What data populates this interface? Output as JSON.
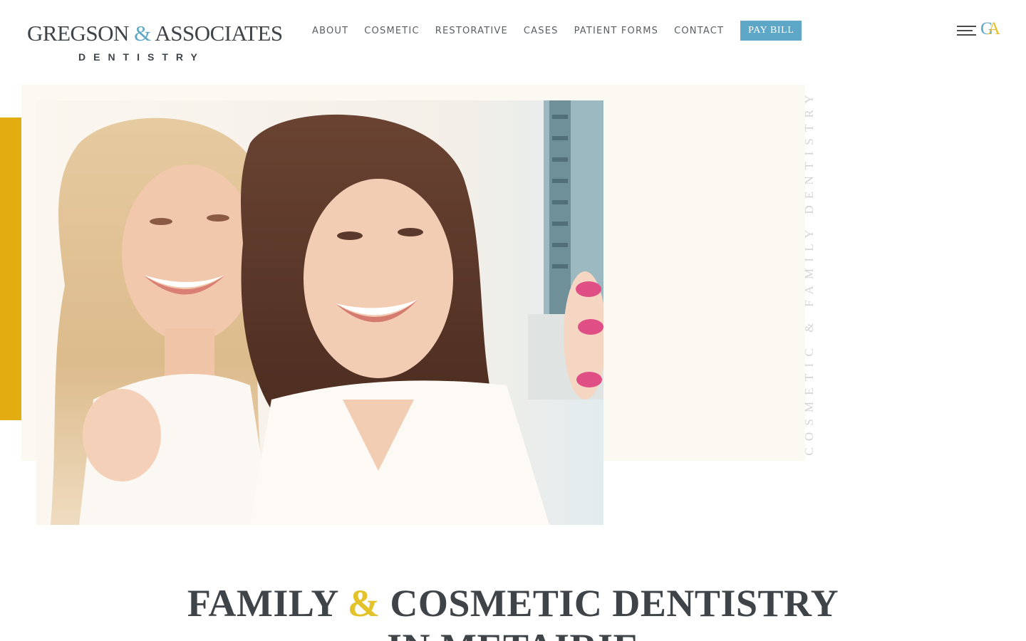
{
  "brand": {
    "name_part1": "GREGSON",
    "ampersand": "&",
    "name_part2": "ASSOCIATES",
    "subtitle": "DENTISTRY",
    "monogram_g": "G",
    "monogram_a": "A"
  },
  "nav": {
    "items": [
      {
        "label": "ABOUT"
      },
      {
        "label": "COSMETIC"
      },
      {
        "label": "RESTORATIVE"
      },
      {
        "label": "CASES"
      },
      {
        "label": "PATIENT FORMS"
      },
      {
        "label": "CONTACT"
      }
    ],
    "pay_bill_label": "PAY BILL"
  },
  "hero": {
    "vertical_tagline": "COSMETIC & FAMILY DENTISTRY"
  },
  "headline": {
    "part1": "FAMILY",
    "ampersand": "&",
    "part2": "COSMETIC DENTISTRY",
    "line2": "IN METAIRIE"
  },
  "colors": {
    "accent_blue": "#5fa7c7",
    "accent_gold": "#e3ad12",
    "accent_yellow": "#e3c22a",
    "text_dark": "#3f4449",
    "hero_cream": "#fbf9f1"
  },
  "icons": {
    "menu": "hamburger-menu-icon",
    "monogram": "ga-monogram-icon"
  }
}
